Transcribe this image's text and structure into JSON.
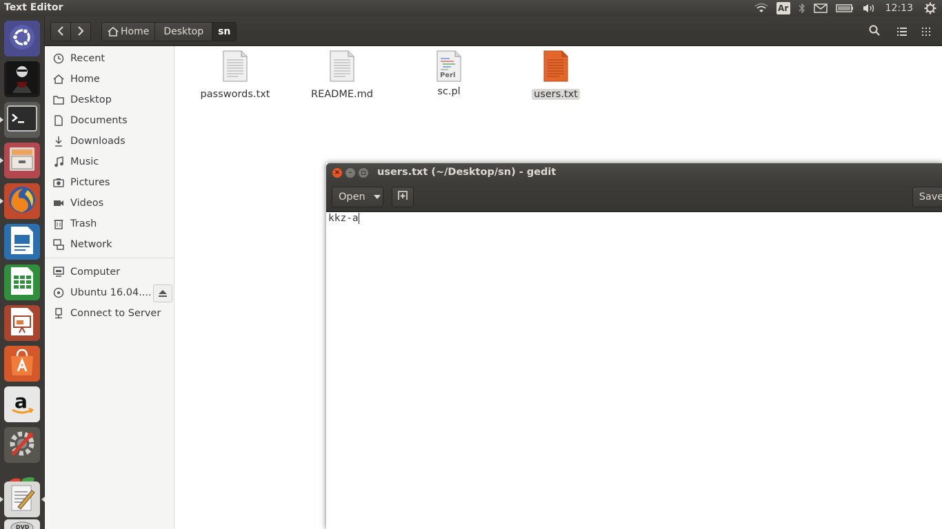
{
  "top_panel": {
    "app_title": "Text Editor",
    "keyboard_layout": "Ar",
    "clock": "12:13"
  },
  "launcher": {
    "items": [
      {
        "name": "dash",
        "icon": "ubuntu-logo-icon"
      },
      {
        "name": "hacker-app",
        "icon": "anonymous-figure-icon"
      },
      {
        "name": "terminal",
        "icon": "terminal-icon"
      },
      {
        "name": "files",
        "icon": "file-cabinet-icon"
      },
      {
        "name": "firefox",
        "icon": "firefox-icon"
      },
      {
        "name": "writer",
        "icon": "libreoffice-writer-icon"
      },
      {
        "name": "calc",
        "icon": "libreoffice-calc-icon"
      },
      {
        "name": "impress",
        "icon": "libreoffice-impress-icon"
      },
      {
        "name": "software-center",
        "icon": "shopping-bag-icon"
      },
      {
        "name": "amazon",
        "icon": "amazon-icon"
      },
      {
        "name": "system-settings",
        "icon": "settings-wrench-icon"
      },
      {
        "name": "windows-app",
        "icon": "windows-logo-icon"
      },
      {
        "name": "text-editor",
        "icon": "text-editor-icon"
      },
      {
        "name": "dvd",
        "icon": "dvd-icon"
      }
    ]
  },
  "nautilus": {
    "breadcrumbs": [
      "Home",
      "Desktop",
      "sn"
    ],
    "sidebar": {
      "places": [
        "Recent",
        "Home",
        "Desktop",
        "Documents",
        "Downloads",
        "Music",
        "Pictures",
        "Videos",
        "Trash",
        "Network"
      ],
      "devices": [
        "Computer",
        "Ubuntu 16.04....",
        "Connect to Server"
      ]
    },
    "files": [
      {
        "name": "passwords.txt",
        "type": "text"
      },
      {
        "name": "README.md",
        "type": "text"
      },
      {
        "name": "sc.pl",
        "type": "perl",
        "badge": "Perl"
      },
      {
        "name": "users.txt",
        "type": "text-selected"
      }
    ]
  },
  "gedit": {
    "title": "users.txt (~/Desktop/sn) - gedit",
    "open_label": "Open",
    "save_label": "Save",
    "content": "kkz-a"
  },
  "colors": {
    "panel": "#3c3b37",
    "ubuntu_orange": "#e95420",
    "close_button": "#e95420",
    "selection": "#dad8d4"
  }
}
